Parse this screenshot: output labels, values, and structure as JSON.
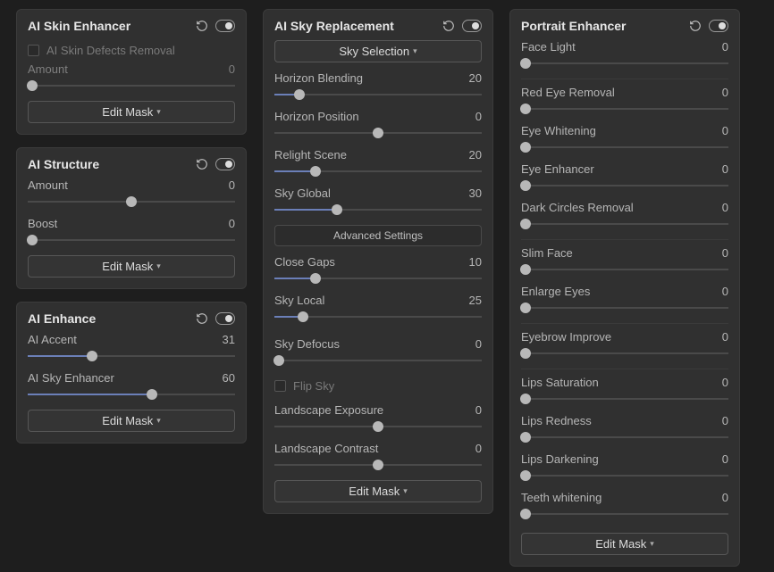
{
  "skin": {
    "title": "AI Skin Enhancer",
    "checkbox": "AI Skin Defects Removal",
    "amount": {
      "label": "Amount",
      "value": "0",
      "pos": 2,
      "fill": 0
    },
    "editMask": "Edit Mask"
  },
  "structure": {
    "title": "AI Structure",
    "amount": {
      "label": "Amount",
      "value": "0",
      "pos": 50,
      "fill": 0
    },
    "boost": {
      "label": "Boost",
      "value": "0",
      "pos": 2,
      "fill": 0
    },
    "editMask": "Edit Mask"
  },
  "enhance": {
    "title": "AI Enhance",
    "accent": {
      "label": "AI Accent",
      "value": "31",
      "pos": 31,
      "fill": 31
    },
    "sky": {
      "label": "AI Sky Enhancer",
      "value": "60",
      "pos": 60,
      "fill": 60
    },
    "editMask": "Edit Mask"
  },
  "skyrepl": {
    "title": "AI Sky Replacement",
    "skySelection": "Sky Selection",
    "horizonBlending": {
      "label": "Horizon Blending",
      "value": "20",
      "pos": 12,
      "fill": 12
    },
    "horizonPosition": {
      "label": "Horizon Position",
      "value": "0",
      "pos": 50,
      "fill": 0
    },
    "relightScene": {
      "label": "Relight Scene",
      "value": "20",
      "pos": 20,
      "fill": 20
    },
    "skyGlobal": {
      "label": "Sky Global",
      "value": "30",
      "pos": 30,
      "fill": 30
    },
    "advanced": "Advanced Settings",
    "closeGaps": {
      "label": "Close Gaps",
      "value": "10",
      "pos": 20,
      "fill": 20
    },
    "skyLocal": {
      "label": "Sky Local",
      "value": "25",
      "pos": 14,
      "fill": 14
    },
    "skyDefocus": {
      "label": "Sky Defocus",
      "value": "0",
      "pos": 2,
      "fill": 0
    },
    "flipSky": "Flip Sky",
    "landExposure": {
      "label": "Landscape Exposure",
      "value": "0",
      "pos": 50,
      "fill": 0
    },
    "landContrast": {
      "label": "Landscape Contrast",
      "value": "0",
      "pos": 50,
      "fill": 0
    },
    "editMask": "Edit Mask"
  },
  "portrait": {
    "title": "Portrait Enhancer",
    "faceLight": {
      "label": "Face Light",
      "value": "0",
      "pos": 2,
      "fill": 0
    },
    "redEye": {
      "label": "Red Eye Removal",
      "value": "0",
      "pos": 2,
      "fill": 0
    },
    "eyeWhiten": {
      "label": "Eye Whitening",
      "value": "0",
      "pos": 2,
      "fill": 0
    },
    "eyeEnhance": {
      "label": "Eye Enhancer",
      "value": "0",
      "pos": 2,
      "fill": 0
    },
    "darkCircles": {
      "label": "Dark Circles Removal",
      "value": "0",
      "pos": 2,
      "fill": 0
    },
    "slimFace": {
      "label": "Slim Face",
      "value": "0",
      "pos": 2,
      "fill": 0
    },
    "enlargeEyes": {
      "label": "Enlarge Eyes",
      "value": "0",
      "pos": 2,
      "fill": 0
    },
    "eyebrow": {
      "label": "Eyebrow Improve",
      "value": "0",
      "pos": 2,
      "fill": 0
    },
    "lipsSat": {
      "label": "Lips Saturation",
      "value": "0",
      "pos": 2,
      "fill": 0
    },
    "lipsRed": {
      "label": "Lips Redness",
      "value": "0",
      "pos": 2,
      "fill": 0
    },
    "lipsDark": {
      "label": "Lips Darkening",
      "value": "0",
      "pos": 2,
      "fill": 0
    },
    "teeth": {
      "label": "Teeth whitening",
      "value": "0",
      "pos": 2,
      "fill": 0
    },
    "editMask": "Edit Mask"
  }
}
